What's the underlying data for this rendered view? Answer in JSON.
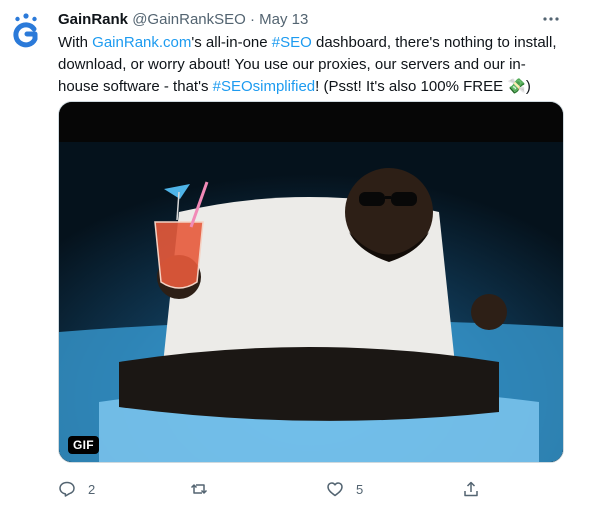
{
  "tweet": {
    "author_name": "GainRank",
    "author_handle": "@GainRankSEO",
    "separator": " · ",
    "date": "May 13",
    "text_parts": [
      {
        "text": "With ",
        "link": false
      },
      {
        "text": "GainRank.com",
        "link": true
      },
      {
        "text": "'s all-in-one ",
        "link": false
      },
      {
        "text": "#SEO",
        "link": true
      },
      {
        "text": " dashboard, there's nothing to install, download, or worry about! You use our proxies, our servers and our in-house software - that's ",
        "link": false
      },
      {
        "text": "#SEOsimplified",
        "link": true
      },
      {
        "text": "! (Psst! It's also 100% FREE 💸)",
        "link": false
      }
    ],
    "media_badge": "GIF",
    "actions": {
      "reply_count": "2",
      "retweet_count": "",
      "like_count": "5"
    }
  },
  "colors": {
    "link": "#1d9bf0",
    "muted": "#536471",
    "brand": "#2b7ad9"
  },
  "icons": {
    "avatar": "gainrank-logo-icon",
    "more": "more-icon",
    "reply": "reply-icon",
    "retweet": "retweet-icon",
    "like": "like-icon",
    "share": "share-icon"
  }
}
